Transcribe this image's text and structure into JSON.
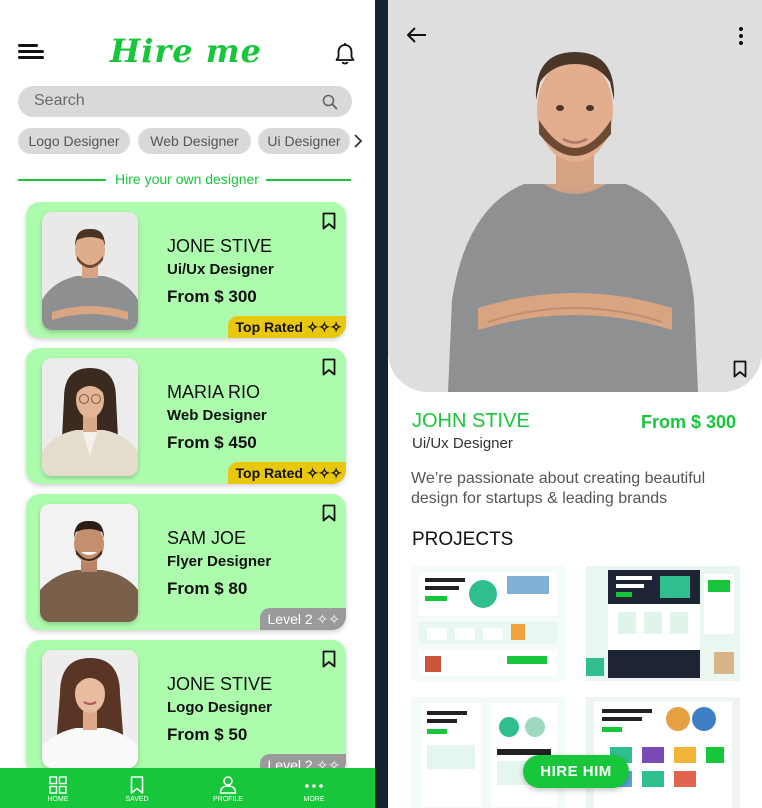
{
  "colors": {
    "accent": "#17c63b",
    "card_bg": "#adfbad",
    "top_rated_badge": "#e8c70c",
    "level_badge": "#9a9a9a",
    "divider": "#14242f"
  },
  "left": {
    "app_title": "Hire me",
    "menu_icon": "hamburger-icon",
    "bell_icon": "bell-icon",
    "search": {
      "placeholder": "Search",
      "icon": "search-icon"
    },
    "chips": [
      "Logo Designer",
      "Web Designer",
      "Ui Designer"
    ],
    "section_label": "Hire your own designer",
    "cards": [
      {
        "name": "JONE STIVE",
        "role": "Ui/Ux Designer",
        "price": "From $ 300",
        "badge": "Top Rated ✧✧✧",
        "badge_type": "top-rated"
      },
      {
        "name": "MARIA RIO",
        "role": "Web Designer",
        "price": "From $ 450",
        "badge": "Top Rated ✧✧✧",
        "badge_type": "top-rated"
      },
      {
        "name": "SAM JOE",
        "role": "Flyer Designer",
        "price": "From $ 80",
        "badge": "Level 2 ✧✧",
        "badge_type": "level"
      },
      {
        "name": "JONE STIVE",
        "role": "Logo Designer",
        "price": "From $ 50",
        "badge": "Level 2 ✧✧",
        "badge_type": "level"
      }
    ],
    "nav": [
      {
        "label": "HOME",
        "icon": "grid-icon"
      },
      {
        "label": "SAVED",
        "icon": "bookmark-icon"
      },
      {
        "label": "PROFILE",
        "icon": "user-icon"
      },
      {
        "label": "MORE",
        "icon": "more-dots-icon"
      }
    ]
  },
  "right": {
    "back_icon": "back-arrow-icon",
    "menu_icon": "kebab-menu-icon",
    "name": "JOHN STIVE",
    "role": "Ui/Ux Designer",
    "price": "From $ 300",
    "description": "We’re passionate about creating beautiful design for startups & leading brands",
    "projects_title": "PROJECTS",
    "hire_button": "HIRE HIM"
  }
}
